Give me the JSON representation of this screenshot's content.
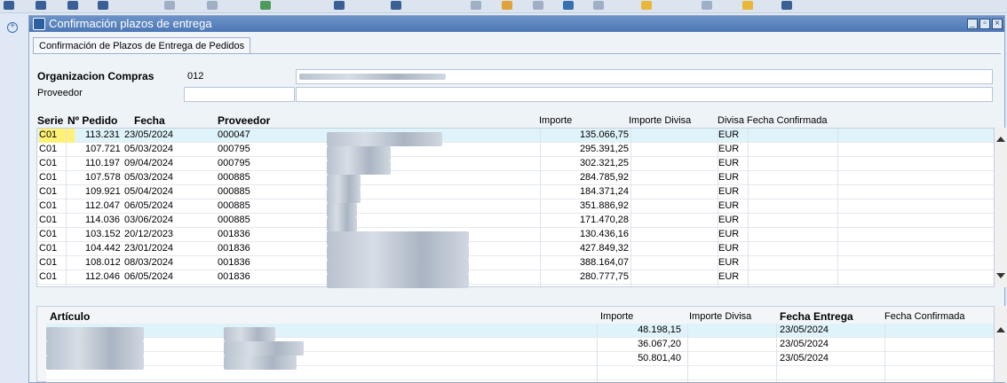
{
  "window": {
    "title": "Confirmación plazos de entrega"
  },
  "tab": {
    "label": "Confirmación de Plazos de Entrega de Pedidos"
  },
  "form": {
    "org_label": "Organizacion Compras",
    "org_value": "012",
    "proveedor_label": "Proveedor"
  },
  "orders": {
    "headers": {
      "serie": "Serie",
      "pedido": "Nº Pedido",
      "fecha": "Fecha",
      "proveedor": "Proveedor",
      "importe": "Importe",
      "importe_divisa": "Importe Divisa",
      "divisa": "Divisa",
      "fecha_confirmada": "Fecha Confirmada"
    },
    "rows": [
      {
        "serie": "C01",
        "pedido": "113.231",
        "fecha": "23/05/2024",
        "proveedor": "000047",
        "importe": "135.066,75",
        "divisa": "EUR"
      },
      {
        "serie": "C01",
        "pedido": "107.721",
        "fecha": "05/03/2024",
        "proveedor": "000795",
        "importe": "295.391,25",
        "divisa": "EUR"
      },
      {
        "serie": "C01",
        "pedido": "110.197",
        "fecha": "09/04/2024",
        "proveedor": "000795",
        "importe": "302.321,25",
        "divisa": "EUR"
      },
      {
        "serie": "C01",
        "pedido": "107.578",
        "fecha": "05/03/2024",
        "proveedor": "000885",
        "importe": "284.785,92",
        "divisa": "EUR"
      },
      {
        "serie": "C01",
        "pedido": "109.921",
        "fecha": "05/04/2024",
        "proveedor": "000885",
        "importe": "184.371,24",
        "divisa": "EUR"
      },
      {
        "serie": "C01",
        "pedido": "112.047",
        "fecha": "06/05/2024",
        "proveedor": "000885",
        "importe": "351.886,92",
        "divisa": "EUR"
      },
      {
        "serie": "C01",
        "pedido": "114.036",
        "fecha": "03/06/2024",
        "proveedor": "000885",
        "importe": "171.470,28",
        "divisa": "EUR"
      },
      {
        "serie": "C01",
        "pedido": "103.152",
        "fecha": "20/12/2023",
        "proveedor": "001836",
        "importe": "130.436,16",
        "divisa": "EUR"
      },
      {
        "serie": "C01",
        "pedido": "104.442",
        "fecha": "23/01/2024",
        "proveedor": "001836",
        "importe": "427.849,32",
        "divisa": "EUR"
      },
      {
        "serie": "C01",
        "pedido": "108.012",
        "fecha": "08/03/2024",
        "proveedor": "001836",
        "importe": "388.164,07",
        "divisa": "EUR"
      },
      {
        "serie": "C01",
        "pedido": "112.046",
        "fecha": "06/05/2024",
        "proveedor": "001836",
        "importe": "280.777,75",
        "divisa": "EUR"
      }
    ]
  },
  "articles": {
    "headers": {
      "articulo": "Artículo",
      "importe": "Importe",
      "importe_divisa": "Importe Divisa",
      "fecha_entrega": "Fecha Entrega",
      "fecha_confirmada": "Fecha Confirmada"
    },
    "rows": [
      {
        "importe": "48.198,15",
        "fecha_entrega": "23/05/2024"
      },
      {
        "importe": "36.067,20",
        "fecha_entrega": "23/05/2024"
      },
      {
        "importe": "50.801,40",
        "fecha_entrega": "23/05/2024"
      }
    ]
  },
  "colors": {
    "title_bar": "#5a82bd",
    "selected_row": "#dff3fa",
    "highlight_cell": "#fff176"
  }
}
